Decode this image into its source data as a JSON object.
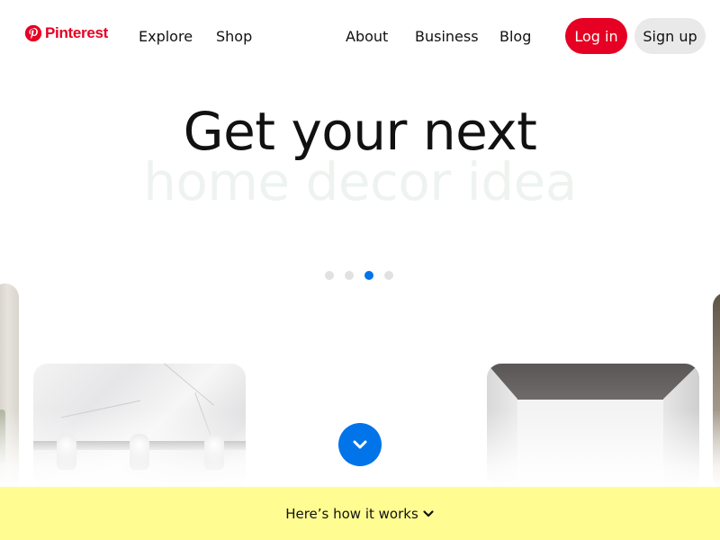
{
  "header": {
    "logo_text": "Pinterest",
    "logo_icon": "pinterest-logo-icon",
    "nav": {
      "explore": "Explore",
      "shop": "Shop",
      "about": "About",
      "business": "Business",
      "blog": "Blog"
    },
    "login_label": "Log in",
    "signup_label": "Sign up"
  },
  "hero": {
    "line1": "Get your next",
    "line2": "home decor idea",
    "carousel": {
      "dot_count": 4,
      "active_index": 2
    }
  },
  "scroll_button": {
    "icon": "chevron-down-icon"
  },
  "banner": {
    "text": "Here’s how it works",
    "icon": "chevron-down-icon"
  },
  "colors": {
    "brand": "#e60023",
    "accent_blue": "#0074e8",
    "banner_bg": "#fffd92",
    "signup_bg": "#e9e9e9",
    "hero_secondary": "#eef3f0"
  }
}
